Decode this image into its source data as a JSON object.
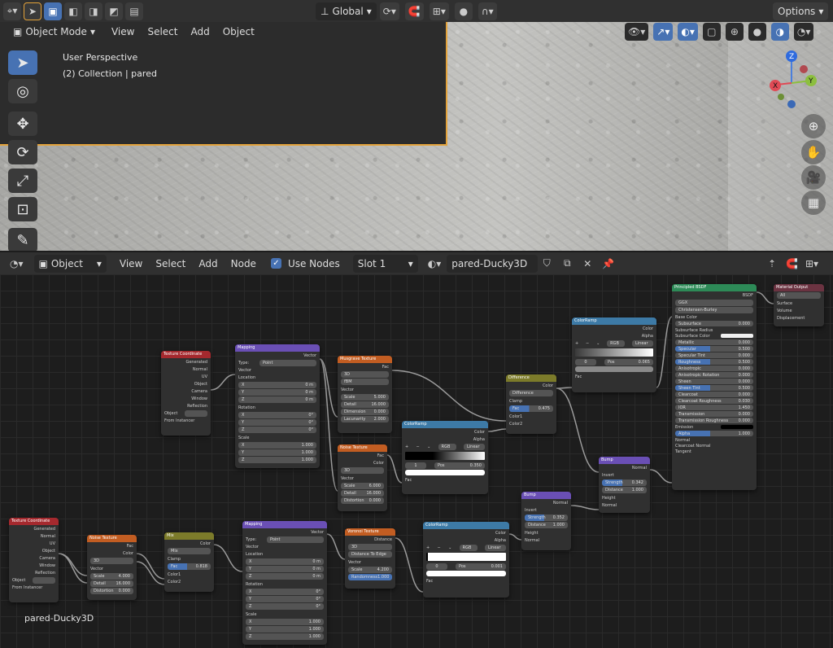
{
  "top_header": {
    "global_label": "Global",
    "options_label": "Options"
  },
  "viewport_header": {
    "mode": "Object Mode",
    "menus": [
      "View",
      "Select",
      "Add",
      "Object"
    ]
  },
  "overlay": {
    "line1": "User Perspective",
    "line2": "(2) Collection | pared"
  },
  "gizmo": {
    "z": "Z",
    "y": "Y",
    "x": "X"
  },
  "node_header": {
    "type": "Object",
    "menus": [
      "View",
      "Select",
      "Add",
      "Node"
    ],
    "use_nodes": "Use Nodes",
    "slot": "Slot 1",
    "material": "pared-Ducky3D"
  },
  "material_name_overlay": "pared-Ducky3D",
  "nodes": {
    "texcoord1": {
      "title": "Texture Coordinate",
      "outputs": [
        "Generated",
        "Normal",
        "UV",
        "Object",
        "Camera",
        "Window",
        "Reflection"
      ],
      "object": "Object",
      "instancer": "From Instancer"
    },
    "mapping1": {
      "title": "Mapping",
      "out": "Vector",
      "type_label": "Type:",
      "type_value": "Point",
      "vector": "Vector",
      "location": "Location",
      "rotation": "Rotation",
      "scale": "Scale",
      "loc": [
        [
          "X",
          "0 m"
        ],
        [
          "Y",
          "0 m"
        ],
        [
          "Z",
          "0 m"
        ]
      ],
      "rot": [
        [
          "X",
          "0°"
        ],
        [
          "Y",
          "0°"
        ],
        [
          "Z",
          "0°"
        ]
      ],
      "scl": [
        [
          "X",
          "1.000"
        ],
        [
          "Y",
          "1.000"
        ],
        [
          "Z",
          "1.000"
        ]
      ]
    },
    "musgrave": {
      "title": "Musgrave Texture",
      "out": "Fac",
      "dim": "3D",
      "type": "fBM",
      "vector": "Vector",
      "fields": [
        [
          "Scale",
          "5.000"
        ],
        [
          "Detail",
          "16.000"
        ],
        [
          "Dimension",
          "0.000"
        ],
        [
          "Lacunarity",
          "2.000"
        ]
      ]
    },
    "noise1": {
      "title": "Noise Texture",
      "outs": [
        "Fac",
        "Color"
      ],
      "dim": "3D",
      "vector": "Vector",
      "fields": [
        [
          "Scale",
          "6.000"
        ],
        [
          "Detail",
          "16.000"
        ],
        [
          "Distortion",
          "0.000"
        ]
      ]
    },
    "ramp1": {
      "title": "ColorRamp",
      "outs": [
        "Color",
        "Alpha"
      ],
      "mode": "RGB",
      "interp": "Linear",
      "stop": "1",
      "pos_label": "Pos",
      "pos": "0.350",
      "fac": "Fac"
    },
    "difference": {
      "title": "Difference",
      "out": "Color",
      "blend": "Difference",
      "clamp": "Clamp",
      "fac_label": "Fac",
      "fac": "0.475",
      "inputs": [
        "Color1",
        "Color2"
      ]
    },
    "ramp2": {
      "title": "ColorRamp",
      "outs": [
        "Color",
        "Alpha"
      ],
      "mode": "RGB",
      "interp": "Linear",
      "stop": "0",
      "pos_label": "Pos",
      "pos": "0.065",
      "fac": "Fac"
    },
    "bsdf": {
      "title": "Principled BSDF",
      "out": "BSDF",
      "dist": "GGX",
      "sss": "Christensen-Burley",
      "rows": [
        [
          "Base Color",
          ""
        ],
        [
          "Subsurface",
          "0.000"
        ],
        [
          "Subsurface Radius",
          ""
        ],
        [
          "Subsurface Color",
          ""
        ],
        [
          "Metallic",
          "0.000"
        ],
        [
          "Specular",
          "0.500"
        ],
        [
          "Specular Tint",
          "0.000"
        ],
        [
          "Roughness",
          "0.500"
        ],
        [
          "Anisotropic",
          "0.000"
        ],
        [
          "Anisotropic Rotation",
          "0.000"
        ],
        [
          "Sheen",
          "0.000"
        ],
        [
          "Sheen Tint",
          "0.500"
        ],
        [
          "Clearcoat",
          "0.000"
        ],
        [
          "Clearcoat Roughness",
          "0.030"
        ],
        [
          "IOR",
          "1.450"
        ],
        [
          "Transmission",
          "0.000"
        ],
        [
          "Transmission Roughness",
          "0.000"
        ],
        [
          "Emission",
          ""
        ],
        [
          "Alpha",
          "1.000"
        ],
        [
          "Normal",
          ""
        ],
        [
          "Clearcoat Normal",
          ""
        ],
        [
          "Tangent",
          ""
        ]
      ]
    },
    "output": {
      "title": "Material Output",
      "target": "All",
      "inputs": [
        "Surface",
        "Volume",
        "Displacement"
      ]
    },
    "bump1": {
      "title": "Bump",
      "out": "Normal",
      "invert": "Invert",
      "fields": [
        [
          "Strength",
          "0.342"
        ],
        [
          "Distance",
          "1.000"
        ]
      ],
      "inputs": [
        "Height",
        "Normal"
      ]
    },
    "texcoord2": {
      "title": "Texture Coordinate",
      "outputs": [
        "Generated",
        "Normal",
        "UV",
        "Object",
        "Camera",
        "Window",
        "Reflection"
      ],
      "object": "Object",
      "instancer": "From Instancer"
    },
    "noise2": {
      "title": "Noise Texture",
      "outs": [
        "Fac",
        "Color"
      ],
      "dim": "3D",
      "vector": "Vector",
      "fields": [
        [
          "Scale",
          "4.000"
        ],
        [
          "Detail",
          "16.000"
        ],
        [
          "Distortion",
          "0.000"
        ]
      ]
    },
    "mix": {
      "title": "Mix",
      "out": "Color",
      "blend": "Mix",
      "clamp": "Clamp",
      "fac_label": "Fac",
      "fac": "0.818",
      "inputs": [
        "Color1",
        "Color2"
      ]
    },
    "mapping2": {
      "title": "Mapping",
      "out": "Vector",
      "type_label": "Type:",
      "type_value": "Point",
      "vector": "Vector",
      "location": "Location",
      "rotation": "Rotation",
      "scale": "Scale",
      "loc": [
        [
          "X",
          "0 m"
        ],
        [
          "Y",
          "0 m"
        ],
        [
          "Z",
          "0 m"
        ]
      ],
      "rot": [
        [
          "X",
          "0°"
        ],
        [
          "Y",
          "0°"
        ],
        [
          "Z",
          "0°"
        ]
      ],
      "scl": [
        [
          "X",
          "1.000"
        ],
        [
          "Y",
          "1.000"
        ],
        [
          "Z",
          "1.000"
        ]
      ]
    },
    "voronoi": {
      "title": "Voronoi Texture",
      "out": "Distance",
      "dim": "3D",
      "feature": "Distance To Edge",
      "vector": "Vector",
      "fields": [
        [
          "Scale",
          "4.200"
        ],
        [
          "Randomness",
          "1.000"
        ]
      ]
    },
    "ramp3": {
      "title": "ColorRamp",
      "outs": [
        "Color",
        "Alpha"
      ],
      "mode": "RGB",
      "interp": "Linear",
      "stop": "0",
      "pos_label": "Pos",
      "pos": "0.001",
      "fac": "Fac"
    },
    "bump2": {
      "title": "Bump",
      "out": "Normal",
      "invert": "Invert",
      "fields": [
        [
          "Strength",
          "0.352"
        ],
        [
          "Distance",
          "1.000"
        ]
      ],
      "inputs": [
        "Height",
        "Normal"
      ]
    }
  },
  "colors": {
    "accent": "#4772b3",
    "selection_outline": "#e3a23a"
  }
}
